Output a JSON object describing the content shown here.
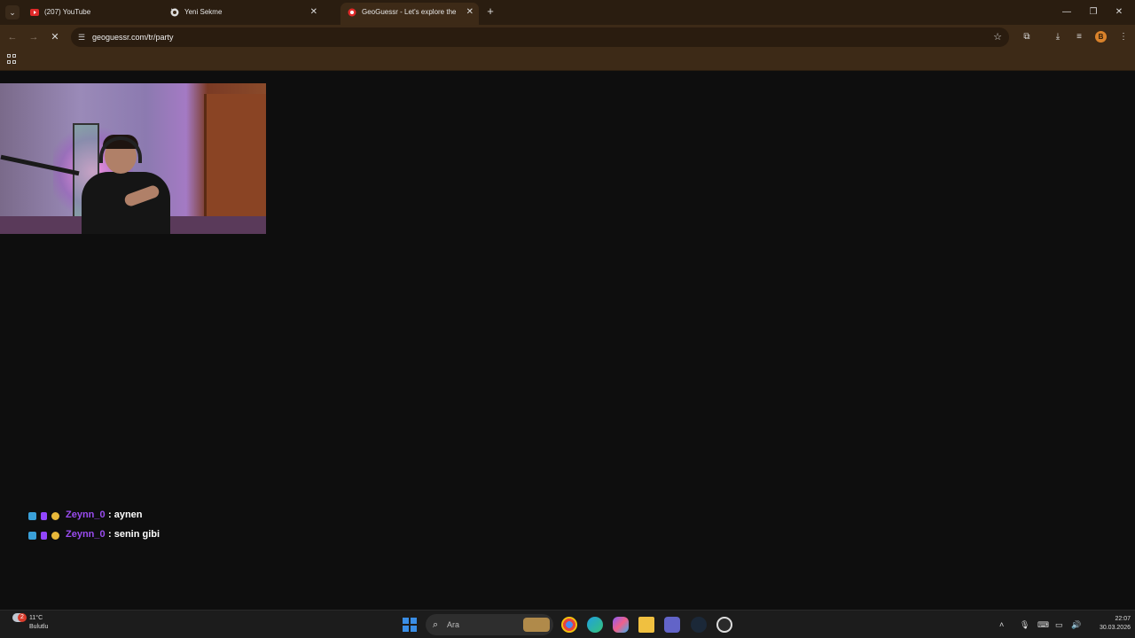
{
  "browser": {
    "tabs": [
      {
        "label": "(207) YouTube",
        "active": false,
        "icon": "youtube-icon"
      },
      {
        "label": "Yeni Sekme",
        "active": false,
        "icon": "chrome-icon"
      },
      {
        "label": "GeoGuessr - Let's explore the",
        "active": true,
        "icon": "geoguessr-icon"
      }
    ],
    "url": "geoguessr.com/tr/party",
    "profile_initial": "B"
  },
  "chat": {
    "messages": [
      {
        "user": "Zeynn_0",
        "text": ": aynen"
      },
      {
        "user": "Zeynn_0",
        "text": ": senin gibi"
      }
    ],
    "name_color": "#9a4cf0"
  },
  "taskbar": {
    "weather_badge": "2",
    "temperature": "11°C",
    "condition": "Bulutlu",
    "search_placeholder": "Ara",
    "time": "22:07",
    "date": "30.03.2026"
  },
  "colors": {
    "browser_frame": "#3d2a17",
    "content_bg": "#0e0e0e",
    "taskbar": "#1c1c1c"
  }
}
